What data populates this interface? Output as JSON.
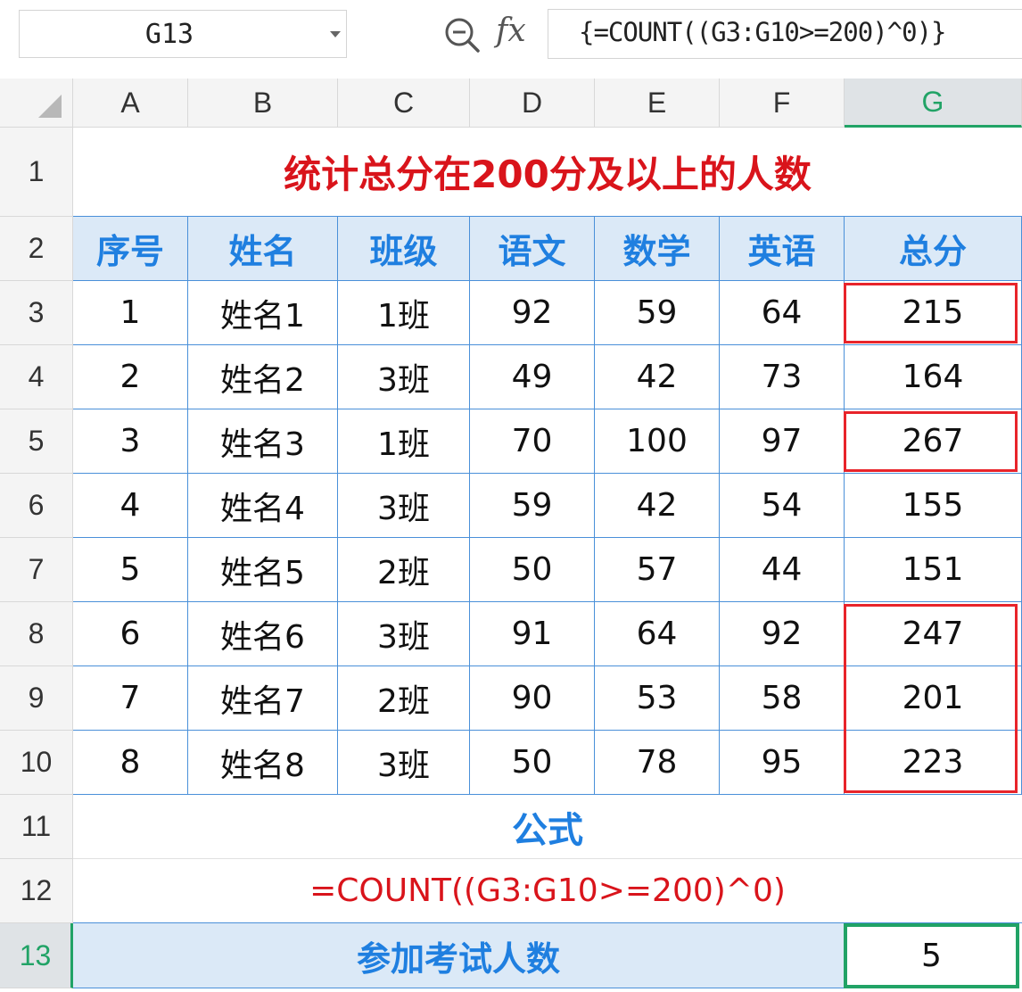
{
  "formula_bar": {
    "name_box": "G13",
    "fx_label": "fx",
    "formula": "{=COUNT((G3:G10>=200)^0)}"
  },
  "columns": [
    "A",
    "B",
    "C",
    "D",
    "E",
    "F",
    "G"
  ],
  "active_column": "G",
  "rows": [
    "1",
    "2",
    "3",
    "4",
    "5",
    "6",
    "7",
    "8",
    "9",
    "10",
    "11",
    "12",
    "13"
  ],
  "active_row": "13",
  "sheet": {
    "title": "统计总分在200分及以上的人数",
    "headers": [
      "序号",
      "姓名",
      "班级",
      "语文",
      "数学",
      "英语",
      "总分"
    ],
    "data": [
      [
        "1",
        "姓名1",
        "1班",
        "92",
        "59",
        "64",
        "215"
      ],
      [
        "2",
        "姓名2",
        "3班",
        "49",
        "42",
        "73",
        "164"
      ],
      [
        "3",
        "姓名3",
        "1班",
        "70",
        "100",
        "97",
        "267"
      ],
      [
        "4",
        "姓名4",
        "3班",
        "59",
        "42",
        "54",
        "155"
      ],
      [
        "5",
        "姓名5",
        "2班",
        "50",
        "57",
        "44",
        "151"
      ],
      [
        "6",
        "姓名6",
        "3班",
        "91",
        "64",
        "92",
        "247"
      ],
      [
        "7",
        "姓名7",
        "2班",
        "90",
        "53",
        "58",
        "201"
      ],
      [
        "8",
        "姓名8",
        "3班",
        "50",
        "78",
        "95",
        "223"
      ]
    ],
    "formula_label": "公式",
    "formula_text": "=COUNT((G3:G10>=200)^0)",
    "total_label": "参加考试人数",
    "total_value": "5"
  },
  "colors": {
    "title_red": "#d9141b",
    "header_blue": "#1f7fe0",
    "header_fill": "#dbe9f7",
    "table_border": "#4a90d9",
    "selection_green": "#21a366",
    "highlight_red": "#e8242a"
  }
}
